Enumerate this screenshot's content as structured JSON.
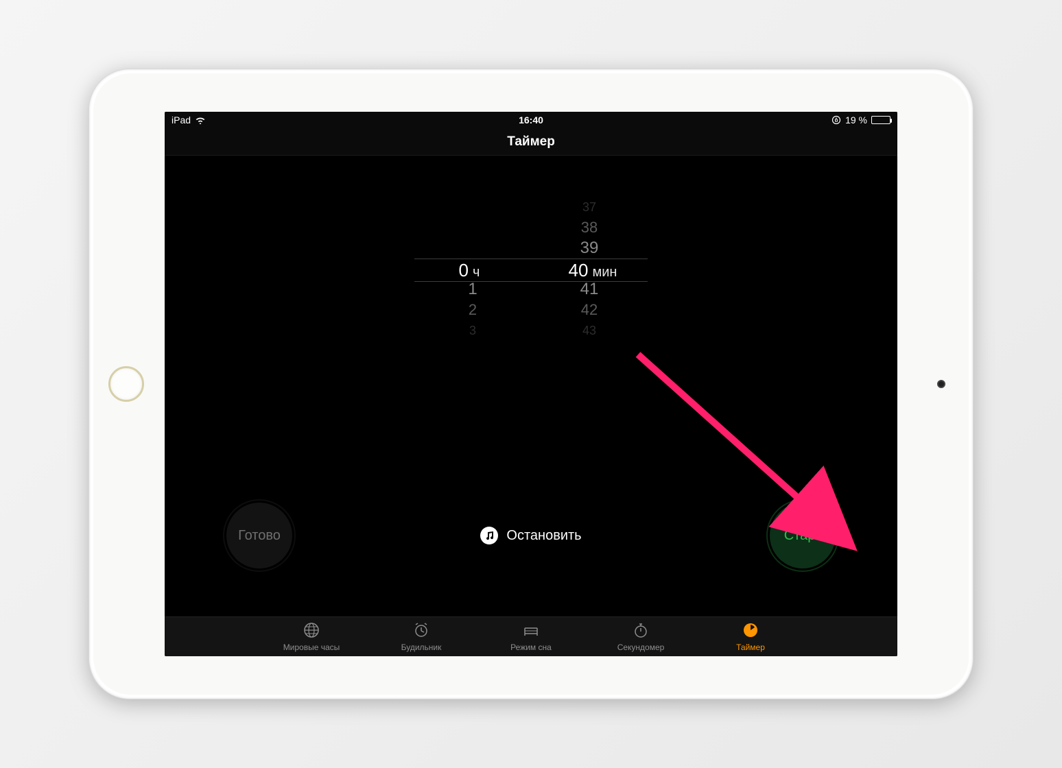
{
  "status": {
    "device": "iPad",
    "time": "16:40",
    "battery": "19 %"
  },
  "header": {
    "title": "Таймер"
  },
  "picker": {
    "hours_label": "ч",
    "minutes_label": "мин",
    "hours_selected": "0",
    "minutes_selected": "40",
    "hours_above": [
      "",
      "",
      ""
    ],
    "hours_below": [
      "1",
      "2",
      "3"
    ],
    "minutes_above": [
      "37",
      "38",
      "39"
    ],
    "minutes_below": [
      "41",
      "42",
      "43"
    ]
  },
  "controls": {
    "cancel_label": "Готово",
    "start_label": "Старт",
    "sound_label": "Остановить"
  },
  "tabs": {
    "world": "Мировые часы",
    "alarm": "Будильник",
    "bedtime": "Режим сна",
    "stopwatch": "Секундомер",
    "timer": "Таймер"
  }
}
